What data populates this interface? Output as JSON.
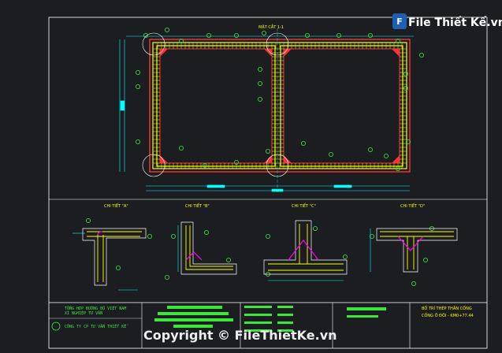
{
  "drawing": {
    "section_title": "MẶT CẮT 1-1",
    "details": [
      {
        "id": "a",
        "label": "CHI TIẾT \"A\""
      },
      {
        "id": "b",
        "label": "CHI TIẾT \"B\""
      },
      {
        "id": "c",
        "label": "CHI TIẾT \"C\""
      },
      {
        "id": "d",
        "label": "CHI TIẾT \"D\""
      }
    ]
  },
  "title_block": {
    "company_line1": "TỔNG HỢP ĐƯỜNG BỘ VIỆT NAM",
    "company_line2": "XÍ NGHIỆP TƯ VẤN",
    "company_line3": "CÔNG TY CP TƯ VẤN THIẾT KẾ",
    "drawing_name": "BỐ TRÍ THÉP THÂN CỐNG",
    "culvert_name": "CỐNG Ô ĐÔI - KM0+77.44"
  },
  "watermark": {
    "logo_text": "File Thiết Kế.vn",
    "copyright": "Copyright © FileThietKe.vn"
  },
  "colors": {
    "background": "#1b1d21",
    "frame": "#ffffff",
    "rebar": "#ffff00",
    "concrete": "#ff3333",
    "dimension": "#00ffff",
    "label": "#39e639",
    "stirrup": "#ff00ff"
  }
}
